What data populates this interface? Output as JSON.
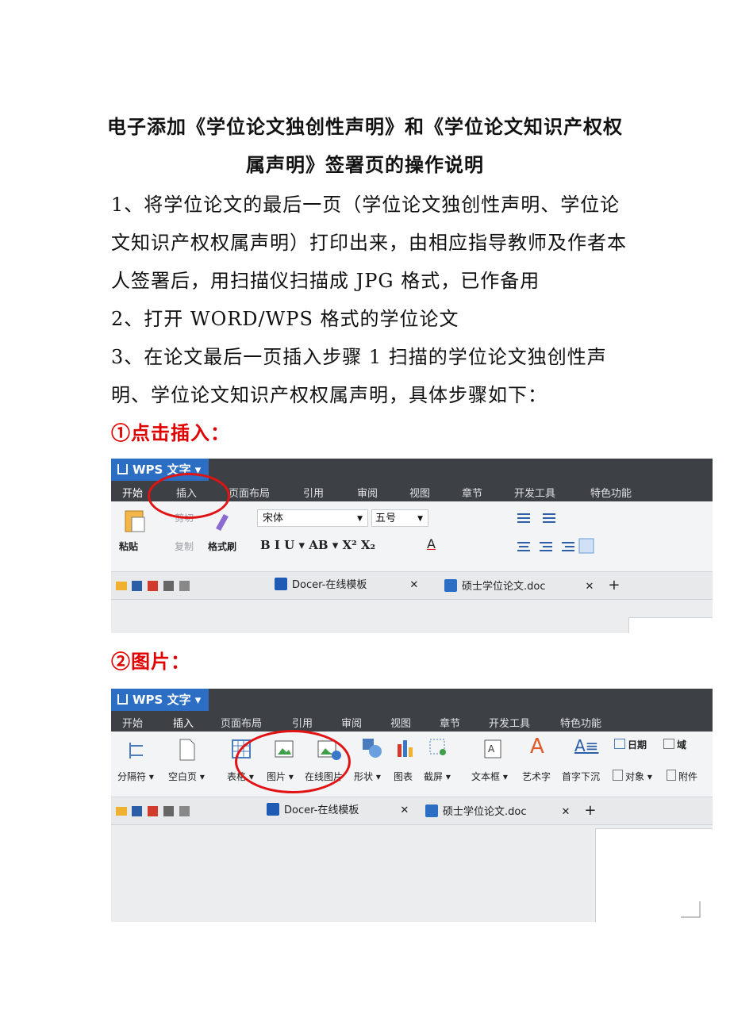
{
  "title": {
    "line1": "电子添加《学位论文独创性声明》和《学位论文知识产权权",
    "line2": "属声明》签署页的操作说明"
  },
  "steps": [
    "1、将学位论文的最后一页（学位论文独创性声明、学位论文知识产权权属声明）打印出来，由相应指导教师及作者本人签署后，用扫描仪扫描成 JPG 格式，已作备用",
    "2、打开 WORD/WPS 格式的学位论文",
    "3、在论文最后一页插入步骤 1 扫描的学位论文独创性声明、学位论文知识产权权属声明，具体步骤如下："
  ],
  "sub1": "①点击插入：",
  "sub2": "②图片：",
  "app": {
    "name": "WPS 文字",
    "menu": [
      "开始",
      "插入",
      "页面布局",
      "引用",
      "审阅",
      "视图",
      "章节",
      "开发工具",
      "特色功能"
    ],
    "tab_docer": "Docer-在线模板",
    "tab_doc": "硕士学位论文.doc"
  },
  "ribbon1": {
    "paste": "粘贴",
    "cut": "剪切",
    "copy": "复制",
    "format_painter": "格式刷",
    "font": "宋体",
    "size": "五号",
    "font_style_buttons": "B  I  U ▾ AB ▾  X²  X₂",
    "font_color_label": "A"
  },
  "ribbon2": {
    "items": [
      "分隔符",
      "空白页",
      "表格",
      "图片",
      "在线图片",
      "形状",
      "图表",
      "截屏",
      "文本框",
      "艺术字",
      "首字下沉"
    ],
    "date": "日期",
    "field": "域",
    "object": "对象",
    "attachment": "附件"
  },
  "colors": {
    "red_text": "#e00000",
    "circle": "#e01414",
    "brand": "#2b6ec3",
    "dark_bar": "#3d4044"
  }
}
